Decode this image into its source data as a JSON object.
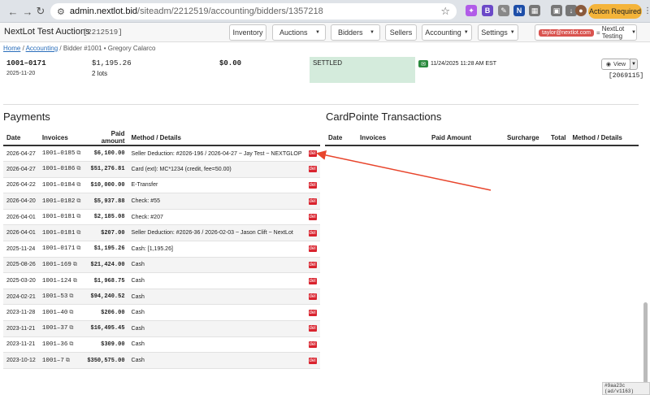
{
  "browser": {
    "url_host": "admin.nextlot.bid",
    "url_path": "/siteadm/2212519/accounting/bidders/1357218",
    "action_required": "Action Required"
  },
  "app": {
    "title": "NextLot Test Auctions",
    "site_id": "[2212519]",
    "nav": {
      "inventory": "Inventory",
      "auctions": "Auctions",
      "bidders": "Bidders",
      "sellers": "Sellers",
      "accounting": "Accounting",
      "settings": "Settings"
    },
    "user_email": "taylor@nextlot.com",
    "user_site": "NextLot Testing"
  },
  "breadcrumb": {
    "home": "Home",
    "accounting": "Accounting",
    "current": "Bidder #1001 • Gregory Calarco"
  },
  "summary": {
    "code": "1001–0171",
    "date": "2025-11-20",
    "amount": "$1,195.26",
    "lots": "2 lots",
    "zero": "$0.00",
    "status": "SETTLED",
    "timestamp": "11/24/2025 11:28 AM EST",
    "view_label": "View",
    "ref": "[2069115]"
  },
  "payments": {
    "title": "Payments",
    "headers": {
      "date": "Date",
      "invoices": "Invoices",
      "paid": "Paid amount",
      "method": "Method / Details"
    },
    "rows": [
      {
        "date": "2026-04-27",
        "invoice": "1001–0185",
        "amount": "$6,100.00",
        "method": "Seller Deduction: #2026-196 / 2026-04-27 ~ Jay Test ~ NEXTGLOP",
        "del": "del"
      },
      {
        "date": "2026-04-27",
        "invoice": "1001–0186",
        "amount": "$51,276.81",
        "method": "Card (ext): MC*1234 (credit, fee=50.00)",
        "del": "del"
      },
      {
        "date": "2026-04-22",
        "invoice": "1001–0184",
        "amount": "$10,000.00",
        "method": "E-Transfer",
        "del": "del"
      },
      {
        "date": "2026-04-20",
        "invoice": "1001–0182",
        "amount": "$5,937.88",
        "method": "Check: #55",
        "del": "del"
      },
      {
        "date": "2026-04-01",
        "invoice": "1001–0181",
        "amount": "$2,185.08",
        "method": "Check: #207",
        "del": "del"
      },
      {
        "date": "2026-04-01",
        "invoice": "1001–0181",
        "amount": "$207.00",
        "method": "Seller Deduction: #2026-36 / 2026-02-03 ~ Jason Clift ~ NextLot",
        "del": "del"
      },
      {
        "date": "2025-11-24",
        "invoice": "1001–0171",
        "amount": "$1,195.26",
        "method": "Cash: [1,195.26]",
        "del": "del"
      },
      {
        "date": "2025-08-26",
        "invoice": "1001–169",
        "amount": "$21,424.00",
        "method": "Cash",
        "del": "del"
      },
      {
        "date": "2025-03-20",
        "invoice": "1001–124",
        "amount": "$1,968.75",
        "method": "Cash",
        "del": "del"
      },
      {
        "date": "2024-02-21",
        "invoice": "1001–53",
        "amount": "$94,240.52",
        "method": "Cash",
        "del": "del"
      },
      {
        "date": "2023-11-28",
        "invoice": "1001–40",
        "amount": "$206.00",
        "method": "Cash",
        "del": "del"
      },
      {
        "date": "2023-11-21",
        "invoice": "1001–37",
        "amount": "$16,495.45",
        "method": "Cash",
        "del": "del"
      },
      {
        "date": "2023-11-21",
        "invoice": "1001–36",
        "amount": "$309.00",
        "method": "Cash",
        "del": "del"
      },
      {
        "date": "2023-10-12",
        "invoice": "1001–7",
        "amount": "$350,575.00",
        "method": "Cash",
        "del": "del"
      }
    ]
  },
  "cardpointe": {
    "title": "CardPointe Transactions",
    "headers": {
      "date": "Date",
      "invoices": "Invoices",
      "paid": "Paid Amount",
      "surcharge": "Surcharge",
      "total": "Total",
      "method": "Method / Details"
    }
  },
  "version": "#9aa23c (ad/v1163)",
  "colors": {
    "annotation_arrow": "#e8452c",
    "del_badge": "#d9232e",
    "settled_bg": "#d4ebdc"
  }
}
